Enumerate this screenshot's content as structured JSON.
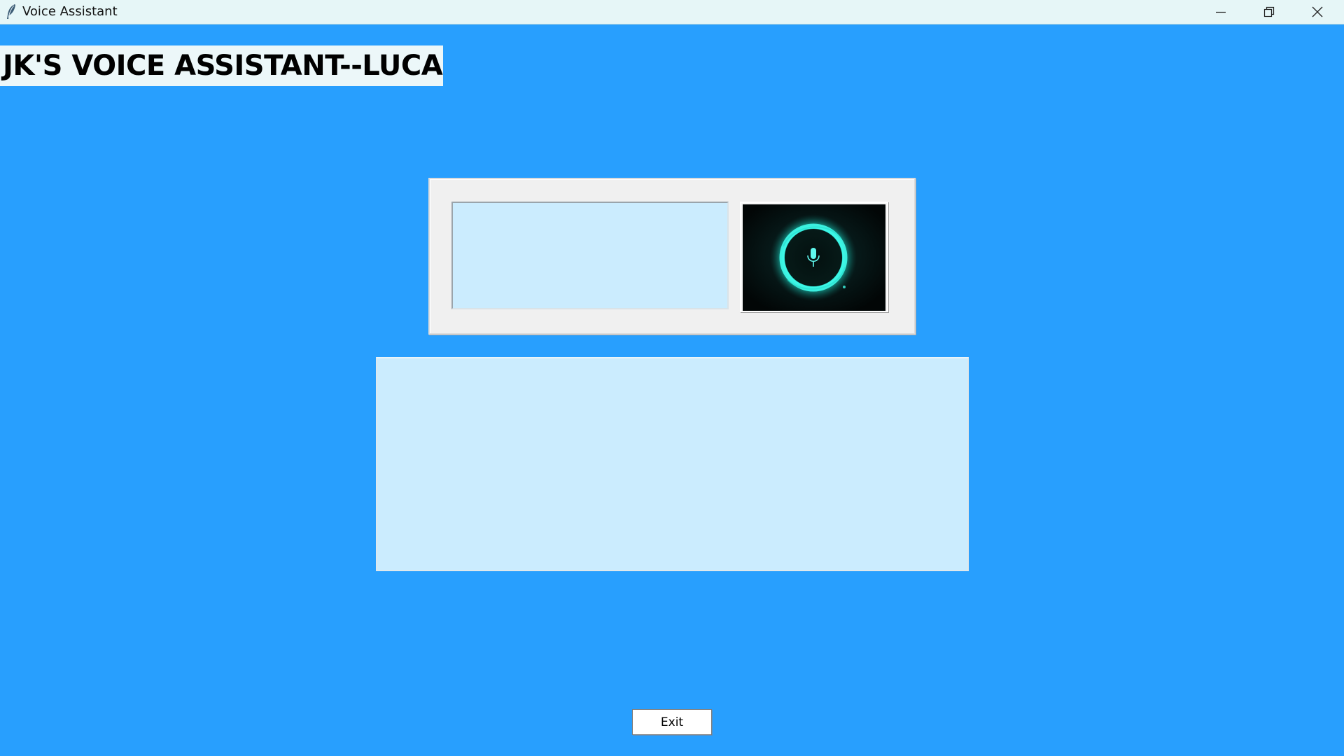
{
  "window": {
    "title": "Voice Assistant",
    "controls": {
      "minimize_icon": "minimize-icon",
      "maximize_icon": "restore-icon",
      "close_icon": "close-icon"
    }
  },
  "header": {
    "title": "JK'S VOICE ASSISTANT--LUCAS"
  },
  "input": {
    "value": "",
    "placeholder": ""
  },
  "mic_button": {
    "icon": "microphone-icon"
  },
  "output": {
    "text": ""
  },
  "footer": {
    "exit_label": "Exit"
  },
  "colors": {
    "background": "#289ffe",
    "text_field_fill": "#cbecfe",
    "frame": "#f0f0f0",
    "title_bar": "#e6f6f7",
    "glow": "#2ff5e6"
  }
}
